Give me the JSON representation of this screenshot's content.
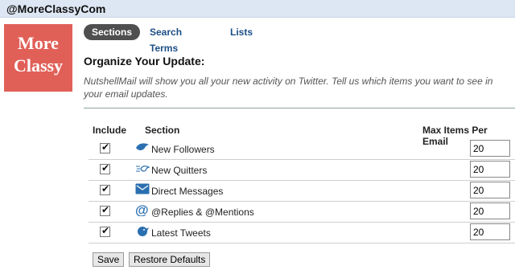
{
  "header": {
    "handle": "@MoreClassyCom"
  },
  "logo": {
    "line1": "More",
    "line2": "Classy",
    "color": "#e06058"
  },
  "tabs": [
    {
      "label": "Sections",
      "active": true
    },
    {
      "label": "Search Terms",
      "active": false
    },
    {
      "label": "Lists",
      "active": false
    }
  ],
  "main": {
    "heading": "Organize Your Update:",
    "description": "NutshellMail will show you all your new activity on Twitter. Tell us which items you want to see in your email updates."
  },
  "table": {
    "headers": {
      "include": "Include",
      "section": "Section",
      "max_items": "Max Items Per Email"
    },
    "rows": [
      {
        "label": "New Followers",
        "icon": "bird-icon",
        "checked": true,
        "max": "20"
      },
      {
        "label": "New Quitters",
        "icon": "bird-flying-away-icon",
        "checked": true,
        "max": "20"
      },
      {
        "label": "Direct Messages",
        "icon": "envelope-icon",
        "checked": true,
        "max": "20"
      },
      {
        "label": "@Replies & @Mentions",
        "icon": "at-sign-icon",
        "checked": true,
        "max": "20"
      },
      {
        "label": "Latest Tweets",
        "icon": "tweet-bird-icon",
        "checked": true,
        "max": "20"
      }
    ]
  },
  "buttons": {
    "save": "Save",
    "restore": "Restore Defaults"
  },
  "colors": {
    "accent": "#1d4e85",
    "topbar": "#dde6f3",
    "active_tab": "#4f4f4f"
  }
}
